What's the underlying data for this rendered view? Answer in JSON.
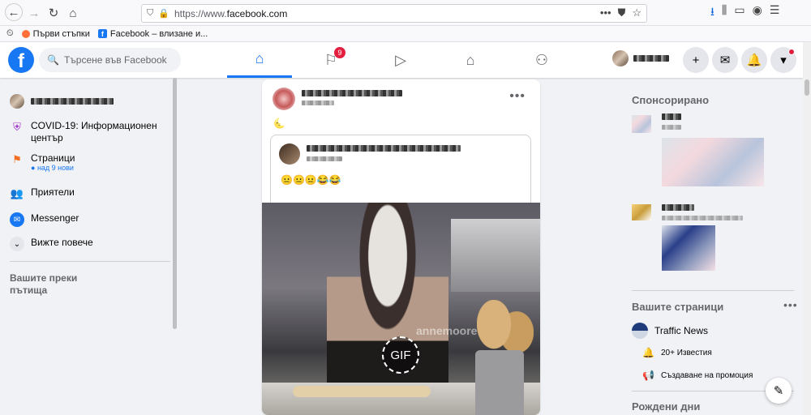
{
  "browser": {
    "url_prefix": "https://www.",
    "url_host": "facebook.com",
    "bookmarks": [
      {
        "label": "Първи стъпки"
      },
      {
        "label": "Facebook – влизане и..."
      }
    ]
  },
  "header": {
    "logo": "f",
    "search_placeholder": "Търсене във Facebook",
    "notifications_badge": "9",
    "accent_color": "#1877f2"
  },
  "left": {
    "covid": "COVID-19: Информационен център",
    "pages": "Страници",
    "pages_new": "над 9 нови",
    "friends": "Приятели",
    "messenger": "Messenger",
    "see_more": "Вижте повече",
    "shortcuts": "Вашите преки пътища"
  },
  "post": {
    "more": "•••",
    "emoji": "🌜",
    "shared_text": "😐😐😐😂😂",
    "watermark": "annemoore",
    "gif_label": "GIF"
  },
  "right": {
    "sponsored": "Спонсорирано",
    "your_pages": "Вашите страници",
    "page_name": "Traffic News",
    "notifications": "20+ Известия",
    "promotion": "Създаване на промоция",
    "birthdays": "Рождени дни",
    "more": "•••"
  }
}
